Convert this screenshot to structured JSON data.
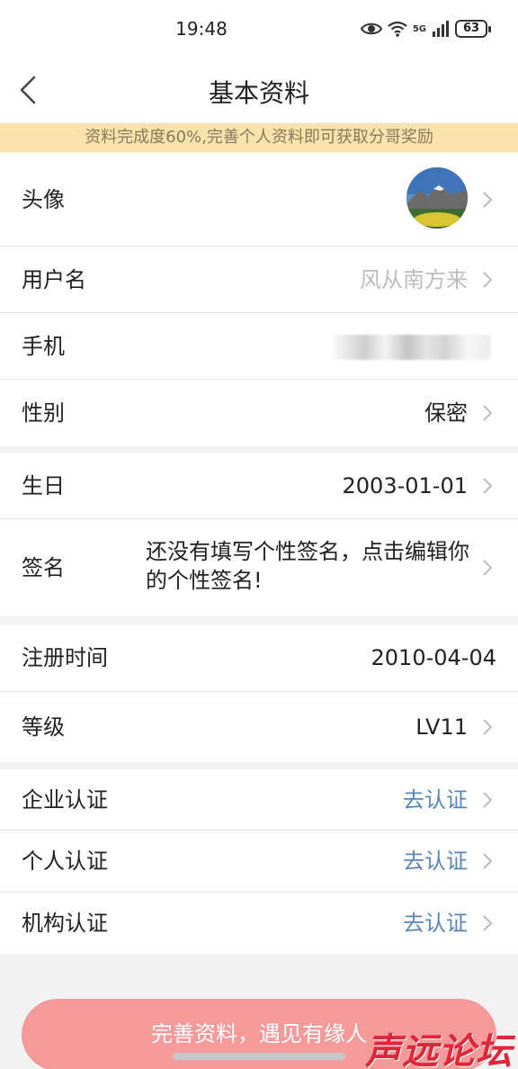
{
  "status_bar": {
    "time": "19:48",
    "network": "5G",
    "battery": "63"
  },
  "nav": {
    "title": "基本资料"
  },
  "banner": {
    "text": "资料完成度60%,完善个人资料即可获取分哥奖励"
  },
  "group1": {
    "avatar_label": "头像",
    "username_label": "用户名",
    "username_value": "风从南方来",
    "phone_label": "手机",
    "gender_label": "性别",
    "gender_value": "保密"
  },
  "group2": {
    "birthday_label": "生日",
    "birthday_value": "2003-01-01",
    "signature_label": "签名",
    "signature_value": "还没有填写个性签名，点击编辑你的个性签名!"
  },
  "group3": {
    "register_label": "注册时间",
    "register_value": "2010-04-04",
    "level_label": "等级",
    "level_value": "LV11"
  },
  "group4": {
    "enterprise_label": "企业认证",
    "enterprise_value": "去认证",
    "personal_label": "个人认证",
    "personal_value": "去认证",
    "org_label": "机构认证",
    "org_value": "去认证"
  },
  "cta": {
    "label": "完善资料，遇见有缘人"
  },
  "watermark": {
    "text": "声远论坛"
  },
  "colors": {
    "banner_bg": "#f8e3ad",
    "link": "#5a86b5",
    "cta_bg": "#f59a9a",
    "watermark": "#e0263a"
  }
}
